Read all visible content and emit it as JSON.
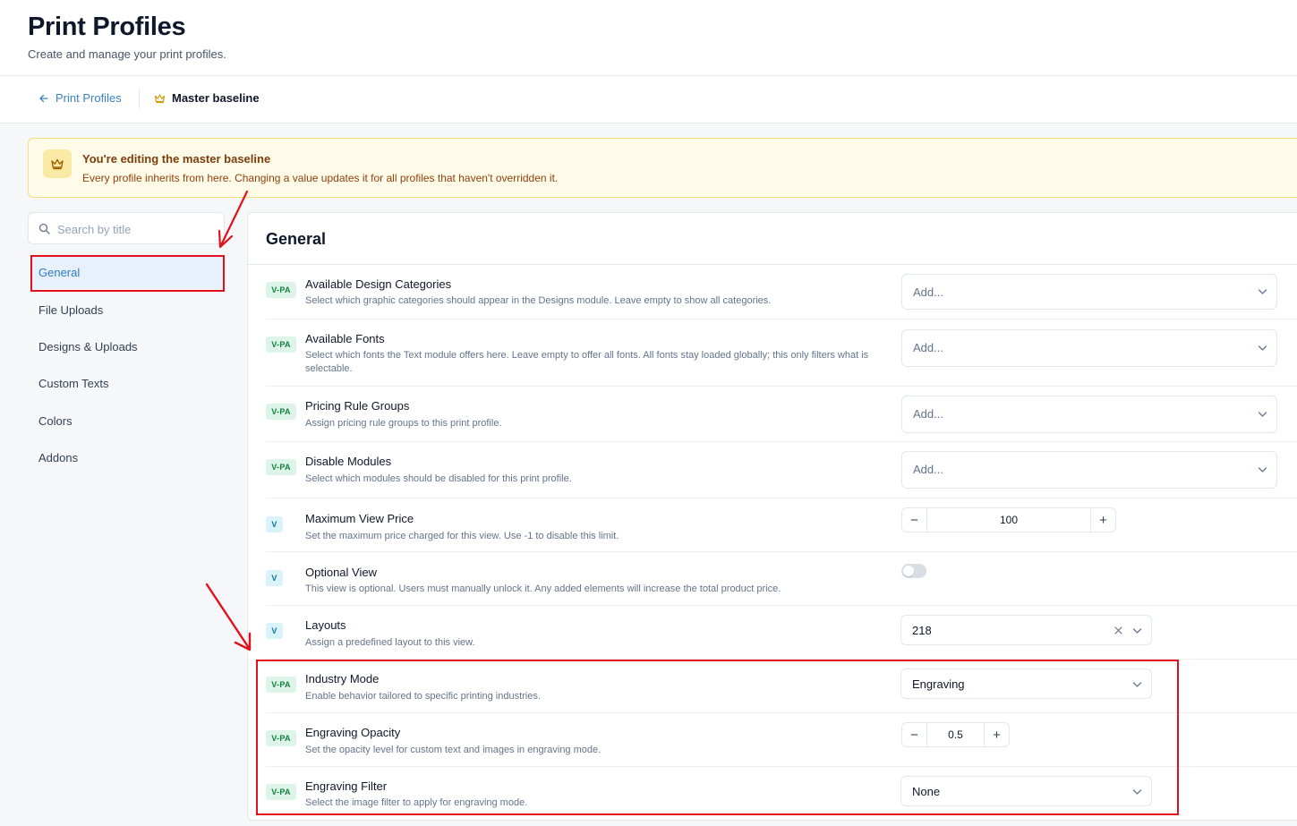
{
  "header": {
    "title": "Print Profiles",
    "subtitle": "Create and manage your print profiles."
  },
  "breadcrumb": {
    "back_label": "Print Profiles",
    "current_label": "Master baseline"
  },
  "banner": {
    "title": "You're editing the master baseline",
    "text": "Every profile inherits from here. Changing a value updates it for all profiles that haven't overridden it."
  },
  "sidebar": {
    "search_placeholder": "Search by title",
    "items": [
      {
        "label": "General",
        "active": true
      },
      {
        "label": "File Uploads"
      },
      {
        "label": "Designs & Uploads"
      },
      {
        "label": "Custom Texts"
      },
      {
        "label": "Colors"
      },
      {
        "label": "Addons"
      }
    ]
  },
  "panel": {
    "title": "General",
    "settings": [
      {
        "badge": "V-PA",
        "title": "Available Design Categories",
        "description": "Select which graphic categories should appear in the Designs module. Leave empty to show all categories.",
        "control": "select",
        "placeholder": "Add..."
      },
      {
        "badge": "V-PA",
        "title": "Available Fonts",
        "description": "Select which fonts the Text module offers here. Leave empty to offer all fonts. All fonts stay loaded globally; this only filters what is selectable.",
        "control": "select",
        "placeholder": "Add..."
      },
      {
        "badge": "V-PA",
        "title": "Pricing Rule Groups",
        "description": "Assign pricing rule groups to this print profile.",
        "control": "select",
        "placeholder": "Add..."
      },
      {
        "badge": "V-PA",
        "title": "Disable Modules",
        "description": "Select which modules should be disabled for this print profile.",
        "control": "select",
        "placeholder": "Add..."
      },
      {
        "badge": "V",
        "title": "Maximum View Price",
        "description": "Set the maximum price charged for this view. Use -1 to disable this limit.",
        "control": "stepper",
        "value": "100"
      },
      {
        "badge": "V",
        "title": "Optional View",
        "description": "This view is optional. Users must manually unlock it. Any added elements will increase the total product price.",
        "control": "toggle",
        "value": "off"
      },
      {
        "badge": "V",
        "title": "Layouts",
        "description": "Assign a predefined layout to this view.",
        "control": "select",
        "value": "218"
      },
      {
        "badge": "V-PA",
        "title": "Industry Mode",
        "description": "Enable behavior tailored to specific printing industries.",
        "control": "select",
        "value": "Engraving"
      },
      {
        "badge": "V-PA",
        "title": "Engraving Opacity",
        "description": "Set the opacity level for custom text and images in engraving mode.",
        "control": "stepper",
        "value": "0.5"
      },
      {
        "badge": "V-PA",
        "title": "Engraving Filter",
        "description": "Select the image filter to apply for engraving mode.",
        "control": "select",
        "value": "None"
      }
    ]
  },
  "colors": {
    "accent": "#2b7bc0",
    "annotation": "#e3101b",
    "banner_bg": "#fefbe8",
    "badge_vpa": "#dcf5e8",
    "badge_v": "#d9f3fb"
  }
}
